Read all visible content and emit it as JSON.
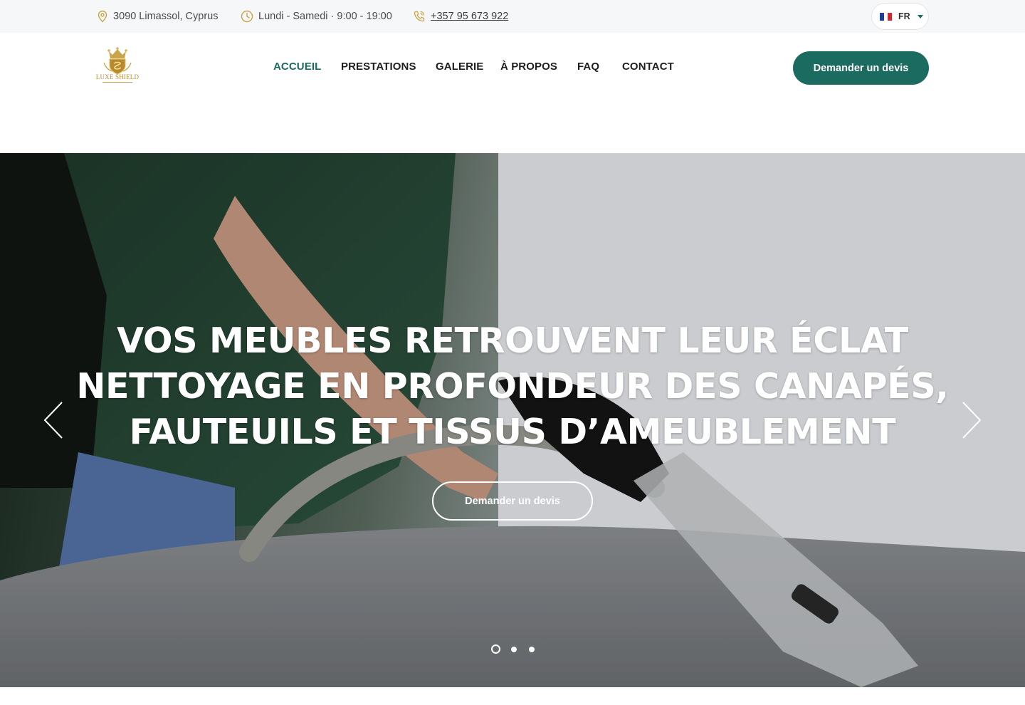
{
  "topbar": {
    "address": "3090 Limassol, Cyprus",
    "hours": "Lundi - Samedi · 9:00 - 19:00",
    "phone": "+357 95 673 922",
    "language": "FR",
    "icons": [
      "map-pin-icon",
      "clock-icon",
      "phone-icon",
      "france-flag-icon",
      "caret-down-icon"
    ]
  },
  "header": {
    "logo_text": "LUXE SHIELD",
    "nav": [
      {
        "label": "ACCUEIL",
        "active": true
      },
      {
        "label": "PRESTATIONS",
        "active": false
      },
      {
        "label": "GALERIE",
        "active": false
      },
      {
        "label": "À PROPOS",
        "active": false
      },
      {
        "label": "FAQ",
        "active": false
      },
      {
        "label": "CONTACT",
        "active": false
      }
    ],
    "cta_label": "Demander un devis"
  },
  "hero": {
    "title_lines": [
      "VOS MEUBLES RETROUVENT LEUR ÉCLAT",
      "NETTOYAGE EN PROFONDEUR DES CANAPÉS,",
      "FAUTEUILS ET TISSUS D’AMEUBLEMENT"
    ],
    "button_label": "Demander un devis",
    "slide_count": 3,
    "active_slide": 1
  },
  "colors": {
    "accent": "#1b6b60",
    "topbar_bg": "#f6f7f8",
    "gold": "#c9a449",
    "text": "#1f1f1f"
  }
}
